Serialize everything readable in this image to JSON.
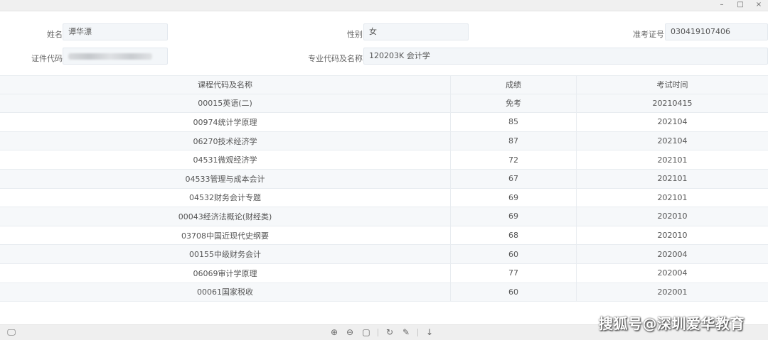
{
  "window_controls": {
    "minimize": "–",
    "maximize": "□",
    "close": "×"
  },
  "form": {
    "name": {
      "label": "姓名",
      "value": "谭华漂"
    },
    "gender": {
      "label": "性别",
      "value": "女"
    },
    "exam_no": {
      "label": "准考证号",
      "value": "030419107406"
    },
    "id_no": {
      "label": "证件代码",
      "value": ""
    },
    "major": {
      "label": "专业代码及名称",
      "value": "120203K 会计学"
    }
  },
  "table": {
    "headers": [
      "课程代码及名称",
      "成绩",
      "考试时间"
    ],
    "rows": [
      [
        "00015英语(二)",
        "免考",
        "20210415"
      ],
      [
        "00974统计学原理",
        "85",
        "202104"
      ],
      [
        "06270技术经济学",
        "87",
        "202104"
      ],
      [
        "04531微观经济学",
        "72",
        "202101"
      ],
      [
        "04533管理与成本会计",
        "67",
        "202101"
      ],
      [
        "04532财务会计专题",
        "69",
        "202101"
      ],
      [
        "00043经济法概论(财经类)",
        "69",
        "202010"
      ],
      [
        "03708中国近现代史纲要",
        "68",
        "202010"
      ],
      [
        "00155中级财务会计",
        "60",
        "202004"
      ],
      [
        "06069审计学原理",
        "77",
        "202004"
      ],
      [
        "00061国家税收",
        "60",
        "202001"
      ]
    ]
  },
  "toolbar": {
    "monitor_icon": "🖵",
    "zoom_in_icon": "⊕",
    "zoom_out_icon": "⊖",
    "fit_icon": "▢",
    "rotate_icon": "↻",
    "edit_icon": "✎",
    "download_icon": "↓"
  },
  "watermark": "搜狐号@深圳爱华教育"
}
